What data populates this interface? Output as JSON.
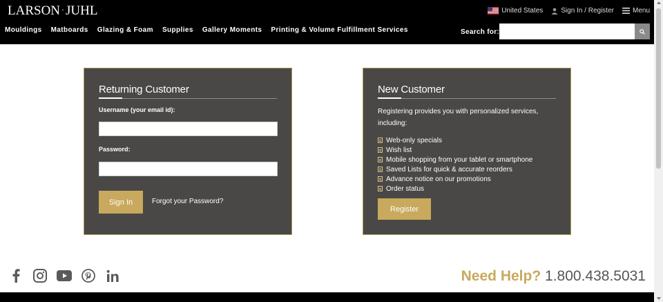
{
  "header": {
    "logo_left": "LARSON",
    "logo_dot": "·",
    "logo_right": "JUHL",
    "country": "United States",
    "signin": "Sign In / Register",
    "menu": "Menu",
    "nav": [
      "Mouldings",
      "Matboards",
      "Glazing & Foam",
      "Supplies",
      "Gallery Moments",
      "Printing & Volume Fulfillment Services"
    ],
    "search_label": "Search for:",
    "search_value": ""
  },
  "returning": {
    "title": "Returning Customer",
    "username_label": "Username (your email id):",
    "password_label": "Password:",
    "signin_button": "Sign In",
    "forgot": "Forgot your Password?"
  },
  "newcustomer": {
    "title": "New Customer",
    "intro": "Registering provides you with personalized services, including:",
    "benefits": [
      "Web-only specials",
      "Wish list",
      "Mobile shopping from your tablet or smartphone",
      "Saved Lists for quick & accurate reorders",
      "Advance notice on our promotions",
      "Order status"
    ],
    "register_button": "Register"
  },
  "footer": {
    "social_icons": [
      "facebook-icon",
      "instagram-icon",
      "youtube-icon",
      "pinterest-icon",
      "linkedin-icon"
    ],
    "need_help": "Need Help?",
    "phone": "1.800.438.5031"
  },
  "colors": {
    "gold": "#c8a95d",
    "panel": "#4a4846",
    "header": "#000000"
  }
}
